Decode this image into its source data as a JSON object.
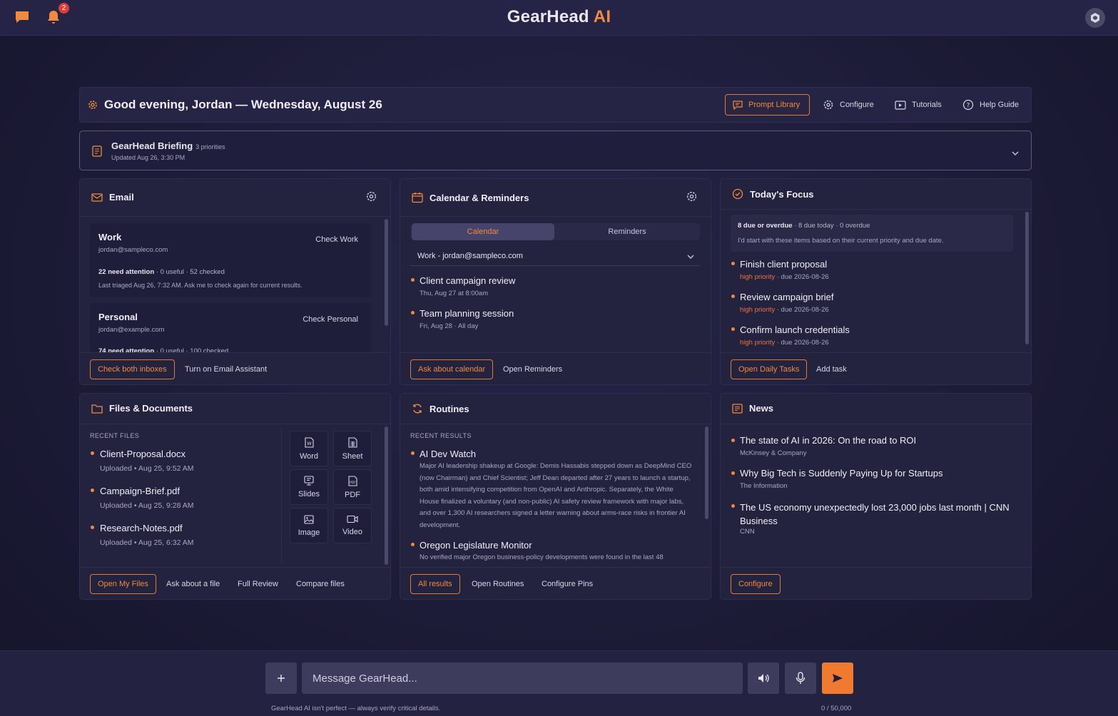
{
  "app": {
    "title_main": "GearHead",
    "title_accent": "AI",
    "notifications_count": "2"
  },
  "header": {
    "greeting": "Good evening, Jordan — Wednesday, August 26",
    "buttons": {
      "prompt_library": "Prompt Library",
      "configure": "Configure",
      "tutorials": "Tutorials",
      "help": "Help Guide"
    }
  },
  "briefing": {
    "title": "GearHead Briefing",
    "priorities": "3 priorities",
    "updated": "Updated Aug 26, 3:30 PM"
  },
  "email": {
    "title": "Email",
    "accounts": [
      {
        "name": "Work",
        "email": "jordan@sampleco.com",
        "attention": "22 need attention",
        "stats": " · 0 useful · 52 checked",
        "last": "Last triaged Aug 26, 7:32 AM. Ask me to check again for current results.",
        "button": "Check Work"
      },
      {
        "name": "Personal",
        "email": "jordan@example.com",
        "attention": "74 need attention",
        "stats": " · 0 useful · 100 checked",
        "button": "Check Personal"
      }
    ],
    "buttons": {
      "check_both": "Check both inboxes",
      "assistant": "Turn on Email Assistant"
    }
  },
  "calendar": {
    "title": "Calendar & Reminders",
    "tabs": [
      "Calendar",
      "Reminders"
    ],
    "selected_calendar": "Work - jordan@sampleco.com",
    "events": [
      {
        "title": "Client campaign review",
        "when": "Thu, Aug 27 at 8:00am"
      },
      {
        "title": "Team planning session",
        "when": "Fri, Aug 28 · All day"
      }
    ],
    "buttons": {
      "ask": "Ask about calendar",
      "open": "Open Reminders"
    }
  },
  "focus": {
    "title": "Today's Focus",
    "summary_bold": "8 due or overdue",
    "summary_rest": " · 8 due today · 0 overdue",
    "note": "I'd start with these items based on their current priority and due date.",
    "tasks": [
      {
        "title": "Finish client proposal",
        "priority": "high priority",
        "due": " · due 2026-08-26"
      },
      {
        "title": "Review campaign brief",
        "priority": "high priority",
        "due": " · due 2026-08-26"
      },
      {
        "title": "Confirm launch credentials",
        "priority": "high priority",
        "due": " · due 2026-08-26"
      }
    ],
    "buttons": {
      "open": "Open Daily Tasks",
      "add": "Add task"
    }
  },
  "files": {
    "title": "Files & Documents",
    "section": "RECENT FILES",
    "items": [
      {
        "name": "Client-Proposal.docx",
        "meta": "Uploaded • Aug 25, 9:52 AM"
      },
      {
        "name": "Campaign-Brief.pdf",
        "meta": "Uploaded • Aug 25, 9:28 AM"
      },
      {
        "name": "Research-Notes.pdf",
        "meta": "Uploaded • Aug 25, 6:32 AM"
      }
    ],
    "create": [
      "Word",
      "Sheet",
      "Slides",
      "PDF",
      "Image",
      "Video"
    ],
    "buttons": {
      "open": "Open My Files",
      "ask": "Ask about a file",
      "review": "Full Review",
      "compare": "Compare files"
    }
  },
  "routines": {
    "title": "Routines",
    "section": "RECENT RESULTS",
    "items": [
      {
        "title": "AI Dev Watch",
        "desc": "Major AI leadership shakeup at Google: Demis Hassabis stepped down as DeepMind CEO (now Chairman) and Chief Scientist; Jeff Dean departed after 27 years to launch a startup, both amid intensifying competition from OpenAI and Anthropic. Separately, the White House finalized a voluntary (and non-public) AI safety review framework with major labs, and over 1,300 AI researchers signed a letter warning about arms-race risks in frontier AI development."
      },
      {
        "title": "Oregon Legislature Monitor",
        "desc": "No verified major Oregon business-policy developments were found in the last 48"
      }
    ],
    "buttons": {
      "all": "All results",
      "open": "Open Routines",
      "pins": "Configure Pins"
    }
  },
  "news": {
    "title": "News",
    "items": [
      {
        "title": "The state of AI in 2026: On the road to ROI",
        "source": "McKinsey & Company"
      },
      {
        "title": "Why Big Tech is Suddenly Paying Up for Startups",
        "source": "The Information"
      },
      {
        "title": "The US economy unexpectedly lost 23,000 jobs last month | CNN Business",
        "source": "CNN"
      }
    ],
    "buttons": {
      "configure": "Configure"
    }
  },
  "composer": {
    "placeholder": "Message GearHead...",
    "disclaimer": "GearHead AI isn't perfect — always verify critical details.",
    "counter": "0 / 50,000"
  },
  "colors": {
    "accent": "#f08a3c",
    "background": "#1e1d3a",
    "panel": "#23223f",
    "high_priority": "#f0733c"
  }
}
